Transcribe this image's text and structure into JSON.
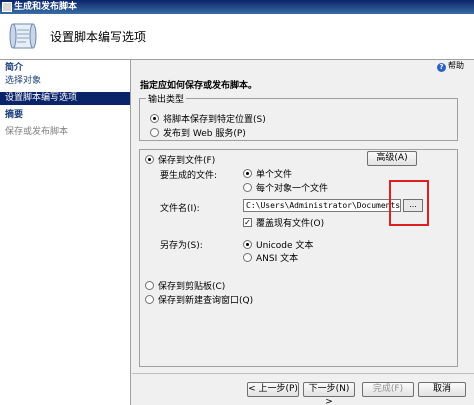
{
  "window": {
    "title": "生成和发布脚本"
  },
  "header": {
    "heading": "设置脚本编写选项"
  },
  "sidebar": {
    "items": [
      {
        "label": "简介",
        "state": "section"
      },
      {
        "label": "选择对象",
        "state": "normal"
      },
      {
        "label": "设置脚本编写选项",
        "state": "selected"
      },
      {
        "label": "摘要",
        "state": "section"
      },
      {
        "label": "保存或发布脚本",
        "state": "disabled"
      }
    ]
  },
  "toolbar": {
    "help_label": "帮助"
  },
  "main": {
    "instruction": "指定应如何保存或发布脚本。",
    "output_type": {
      "legend": "输出类型",
      "options": [
        {
          "label": "将脚本保存到特定位置(S)",
          "selected": true
        },
        {
          "label": "发布到 Web 服务(P)",
          "selected": false
        }
      ]
    },
    "save_to_file": {
      "label": "保存到文件(F)",
      "selected": true,
      "advanced_button": "高级(A)",
      "files_to_generate": {
        "label": "要生成的文件:",
        "options": [
          {
            "label": "单个文件",
            "selected": true
          },
          {
            "label": "每个对象一个文件",
            "selected": false
          }
        ]
      },
      "file_name": {
        "label": "文件名(I):",
        "value": "C:\\Users\\Administrator\\Documents\\script",
        "browse_label": "..."
      },
      "overwrite": {
        "label": "覆盖现有文件(O)",
        "checked": true
      },
      "save_as": {
        "label": "另存为(S):",
        "options": [
          {
            "label": "Unicode 文本",
            "selected": true
          },
          {
            "label": "ANSI 文本",
            "selected": false
          }
        ]
      }
    },
    "save_to_clipboard": {
      "label": "保存到剪贴板(C)",
      "selected": false
    },
    "save_to_query_window": {
      "label": "保存到新建查询窗口(Q)",
      "selected": false
    }
  },
  "footer": {
    "prev_button": "< 上一步(P)",
    "next_button": "下一步(N) >",
    "finish_button": "完成(F)",
    "cancel_button": "取消"
  }
}
